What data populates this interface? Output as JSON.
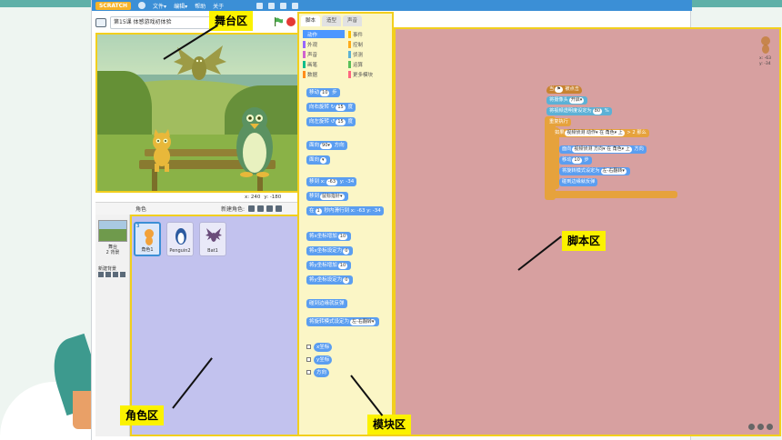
{
  "colors": {
    "stage_highlight": "#f2cf1d",
    "sprite_area": "#c2c2ee",
    "palette_area": "#fbf6c6",
    "script_area": "#d7a0a0",
    "callout_bg": "#fbf200",
    "motion_block": "#5b9ef0",
    "looks_block": "#9966ff",
    "events_block": "#c88330",
    "control_block": "#e6a23c",
    "sensing_block": "#5cb1d6"
  },
  "menubar": {
    "logo": "SCRATCH",
    "menus": [
      "文件▾",
      "编辑▾",
      "帮助",
      "关于"
    ],
    "icons": [
      "globe-icon",
      "duplicate-icon",
      "cut-icon",
      "grow-icon",
      "shrink-icon"
    ]
  },
  "project": {
    "title": "第15课 体感游戏初体验"
  },
  "stage": {
    "mouse_x_label": "x: 240",
    "mouse_y_label": "y: -180"
  },
  "sprites_pane": {
    "label": "角色",
    "new_sprite_label": "新建角色:",
    "stage_label": "舞台",
    "stage_sub": "2 背景",
    "new_backdrop_label": "新建背景",
    "sprites": [
      {
        "index": "3",
        "name": "角色1",
        "selected": true
      },
      {
        "index": "",
        "name": "Penguin2",
        "selected": false
      },
      {
        "index": "",
        "name": "Bat1",
        "selected": false
      }
    ]
  },
  "palette": {
    "tabs": [
      {
        "label": "脚本",
        "active": true
      },
      {
        "label": "造型",
        "active": false
      },
      {
        "label": "声音",
        "active": false
      }
    ],
    "categories": [
      {
        "label": "动作",
        "color": "#4c97ff",
        "active": true
      },
      {
        "label": "事件",
        "color": "#ffbf00",
        "active": false
      },
      {
        "label": "外观",
        "color": "#9966ff",
        "active": false
      },
      {
        "label": "控制",
        "color": "#ffab19",
        "active": false
      },
      {
        "label": "声音",
        "color": "#cf63cf",
        "active": false
      },
      {
        "label": "侦测",
        "color": "#5cb1d6",
        "active": false
      },
      {
        "label": "画笔",
        "color": "#0fbd8c",
        "active": false
      },
      {
        "label": "运算",
        "color": "#59c059",
        "active": false
      },
      {
        "label": "数据",
        "color": "#ff8c1a",
        "active": false
      },
      {
        "label": "更多模块",
        "color": "#ff6680",
        "active": false
      }
    ],
    "blocks": [
      {
        "text": "移动",
        "slot": "10",
        "suffix": "步"
      },
      {
        "text": "向右旋转 ↻",
        "slot": "15",
        "suffix": "度"
      },
      {
        "text": "向左旋转 ↺",
        "slot": "15",
        "suffix": "度"
      },
      {
        "text": "面向",
        "slot": "90▾",
        "suffix": "方向"
      },
      {
        "text": "面向",
        "slot": "▾",
        "suffix": ""
      },
      {
        "text": "移到 x:",
        "slot": "-63",
        "suffix": "y: -34"
      },
      {
        "text": "移到",
        "slot": "鼠标指针▾",
        "suffix": ""
      },
      {
        "text": "在",
        "slot": "1",
        "suffix": "秒内滑行到 x: -63 y: -34"
      },
      {
        "text": "将x坐标增加",
        "slot": "10",
        "suffix": ""
      },
      {
        "text": "将x坐标设定为",
        "slot": "0",
        "suffix": ""
      },
      {
        "text": "将y坐标增加",
        "slot": "10",
        "suffix": ""
      },
      {
        "text": "将y坐标设定为",
        "slot": "0",
        "suffix": ""
      },
      {
        "text": "碰到边缘就反弹",
        "slot": "",
        "suffix": ""
      },
      {
        "text": "将旋转模式设定为",
        "slot": "左-右翻转▾",
        "suffix": ""
      }
    ],
    "reporters": [
      "x坐标",
      "y坐标",
      "方向"
    ]
  },
  "script": {
    "blocks": [
      {
        "text": "当",
        "slot": "⚑",
        "suffix": "被点击",
        "kind": "events"
      },
      {
        "text": "将摄像头",
        "slot": "开启▾",
        "suffix": "",
        "kind": "sensing"
      },
      {
        "text": "将视频透明度设定为",
        "slot": "80",
        "suffix": "%",
        "kind": "sensing"
      },
      {
        "text": "重复执行",
        "slot": "",
        "suffix": "",
        "kind": "control"
      },
      {
        "text": "如果",
        "slot": "视频侦测 动作▾ 在 角色▾ 上",
        "suffix": "> 2 那么",
        "kind": "control"
      },
      {
        "text": "面向",
        "slot": "视频侦测 方向▾ 在 角色▾ 上",
        "suffix": "方向",
        "kind": "motion"
      },
      {
        "text": "移动",
        "slot": "10",
        "suffix": "步",
        "kind": "motion"
      },
      {
        "text": "将旋转模式设定为",
        "slot": "左-右翻转▾",
        "suffix": "",
        "kind": "motion"
      },
      {
        "text": "碰到边缘就反弹",
        "slot": "",
        "suffix": "",
        "kind": "motion"
      }
    ],
    "corner_x": "x: -63",
    "corner_y": "y: -34"
  },
  "callouts": {
    "stage": "舞台区",
    "sprites": "角色区",
    "blocks": "模块区",
    "scripts": "脚本区"
  }
}
